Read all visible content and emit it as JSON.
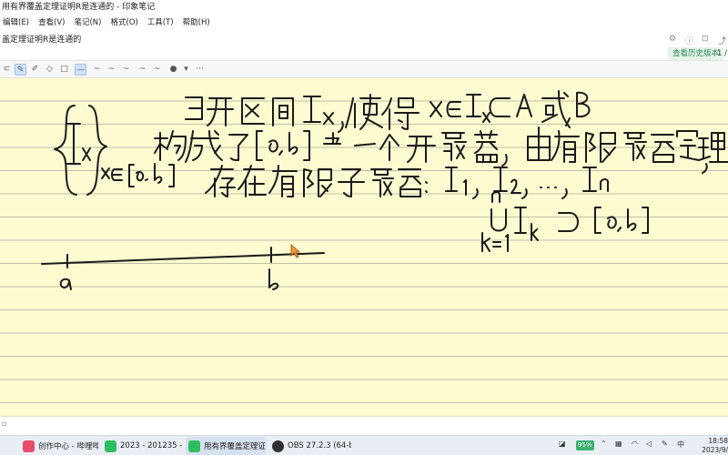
{
  "window": {
    "title": "用有界覆盖定理证明R是连通的 - 印象笔记"
  },
  "menu": [
    "编辑(E)",
    "查看(V)",
    "笔记(N)",
    "格式(O)",
    "工具(T)",
    "帮助(H)"
  ],
  "note": {
    "title": "盖定理证明R是连通的",
    "history_button": "查看历史版本",
    "page_number": "1 /"
  },
  "taskbar": {
    "items": [
      {
        "label": "创作中心 - 哔哩哔...",
        "color": "#e94b6b"
      },
      {
        "label": "2023 - 201235 - ...",
        "color": "#2dbe60"
      },
      {
        "label": "用有界覆盖定理证...",
        "color": "#2dbe60"
      },
      {
        "label": "OBS 27.2.3 (64-bi...",
        "color": "#302e31"
      }
    ],
    "battery": "95%",
    "time": "18:58",
    "date": "2023/9/"
  }
}
